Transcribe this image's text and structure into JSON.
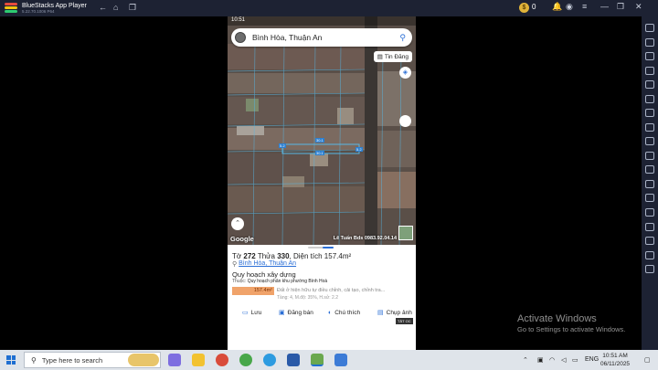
{
  "window": {
    "title": "BlueStacks App Player",
    "version": "5.22.70.1006 P64",
    "coins": "0"
  },
  "phone": {
    "status_time": "10:51",
    "search": {
      "placeholder": "Bình Hòa, Thuận An"
    },
    "tin_dang_label": "Tin Đăng",
    "map": {
      "google_label": "Google",
      "owner_label": "Lê Tuấn Bds 0983.92.04.14",
      "plot_labels": [
        "30.1",
        "30.1",
        "5.2",
        "5.2"
      ]
    },
    "sheet": {
      "parcel": {
        "to_prefix": "Tờ",
        "to": "272",
        "thua_prefix": "Thửa",
        "thua": "330",
        "area_prefix": ", Diện tích",
        "area": "157.4m²"
      },
      "location_link": "Bình Hòa, Thuận An",
      "planning_title": "Quy hoạch xây dựng",
      "planning_sub_prefix": "Thuộc:",
      "planning_sub": "Quy hoạch phân khu phường Bình Hoà",
      "zone_area": "157.4m²",
      "zone_desc": "Đất ở hiện hữu tự điều chỉnh, cải tạo, chỉnh tra...",
      "zone_sub": "Tầng: 4, M.độ: 35%, H.sử: 2.2",
      "actions": [
        {
          "label": "Lưu",
          "icon": "bookmark-icon"
        },
        {
          "label": "Đăng bán",
          "icon": "megaphone-icon"
        },
        {
          "label": "Chú thích",
          "icon": "note-icon"
        },
        {
          "label": "Chụp ảnh",
          "icon": "camera-icon"
        }
      ],
      "tat_oc": "TẮT OC"
    }
  },
  "watermark": {
    "title": "Activate Windows",
    "subtitle": "Go to Settings to activate Windows."
  },
  "taskbar": {
    "search_placeholder": "Type here to search",
    "lang": "ENG",
    "time": "10:51 AM",
    "date": "06/11/2025"
  },
  "colors": {
    "bluestacks_bar": "#1d2233",
    "map_accent": "#57b8e6",
    "link_blue": "#2b6fd6",
    "zone_orange": "#f0a36a"
  }
}
